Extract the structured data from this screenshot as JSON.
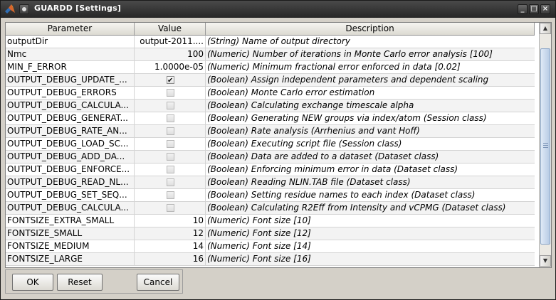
{
  "window": {
    "title": "GUARDD [Settings]"
  },
  "columns": [
    "Parameter",
    "Value",
    "Description"
  ],
  "rows": [
    {
      "param": "outputDir",
      "type": "text",
      "value": "output-2011....",
      "desc": "(String) Name of output directory"
    },
    {
      "param": "Nmc",
      "type": "text",
      "value": "100",
      "desc": "(Numeric) Number of iterations in Monte Carlo error analysis [100]"
    },
    {
      "param": "MIN_F_ERROR",
      "type": "text",
      "value": "1.0000e-05",
      "desc": "(Numeric) Minimum fractional error enforced in data [0.02]"
    },
    {
      "param": "OUTPUT_DEBUG_UPDATE_...",
      "type": "check",
      "checked": true,
      "desc": "(Boolean) Assign independent parameters and dependent scaling"
    },
    {
      "param": "OUTPUT_DEBUG_ERRORS",
      "type": "check",
      "checked": false,
      "desc": "(Boolean) Monte Carlo error estimation"
    },
    {
      "param": "OUTPUT_DEBUG_CALCULA...",
      "type": "check",
      "checked": false,
      "desc": "(Boolean) Calculating exchange timescale alpha"
    },
    {
      "param": "OUTPUT_DEBUG_GENERAT...",
      "type": "check",
      "checked": false,
      "desc": "(Boolean) Generating NEW groups via index/atom (Session class)"
    },
    {
      "param": "OUTPUT_DEBUG_RATE_AN...",
      "type": "check",
      "checked": false,
      "desc": "(Boolean) Rate analysis (Arrhenius and vant Hoff)"
    },
    {
      "param": "OUTPUT_DEBUG_LOAD_SC...",
      "type": "check",
      "checked": false,
      "desc": "(Boolean) Executing script file (Session class)"
    },
    {
      "param": "OUTPUT_DEBUG_ADD_DA...",
      "type": "check",
      "checked": false,
      "desc": "(Boolean) Data are added to a dataset (Dataset class)"
    },
    {
      "param": "OUTPUT_DEBUG_ENFORCE...",
      "type": "check",
      "checked": false,
      "desc": "(Boolean) Enforcing minimum error in data (Dataset class)"
    },
    {
      "param": "OUTPUT_DEBUG_READ_NL...",
      "type": "check",
      "checked": false,
      "desc": "(Boolean) Reading NLIN.TAB file (Dataset class)"
    },
    {
      "param": "OUTPUT_DEBUG_SET_SEQ...",
      "type": "check",
      "checked": false,
      "desc": "(Boolean) Setting residue names to each index (Dataset class)"
    },
    {
      "param": "OUTPUT_DEBUG_CALCULA...",
      "type": "check",
      "checked": false,
      "desc": "(Boolean) Calculating R2Eff from Intensity and vCPMG (Dataset class)"
    },
    {
      "param": "FONTSIZE_EXTRA_SMALL",
      "type": "text",
      "value": "10",
      "desc": "(Numeric) Font size [10]"
    },
    {
      "param": "FONTSIZE_SMALL",
      "type": "text",
      "value": "12",
      "desc": "(Numeric) Font size [12]"
    },
    {
      "param": "FONTSIZE_MEDIUM",
      "type": "text",
      "value": "14",
      "desc": "(Numeric) Font size [14]"
    },
    {
      "param": "FONTSIZE_LARGE",
      "type": "text",
      "value": "16",
      "desc": "(Numeric) Font size [16]"
    }
  ],
  "buttons": {
    "ok": "OK",
    "reset": "Reset",
    "cancel": "Cancel"
  },
  "icons": {
    "app": "matlab-logo-icon",
    "menu": "window-menu-icon",
    "minimize": "minimize-icon",
    "maximize": "maximize-icon",
    "close": "close-icon"
  }
}
